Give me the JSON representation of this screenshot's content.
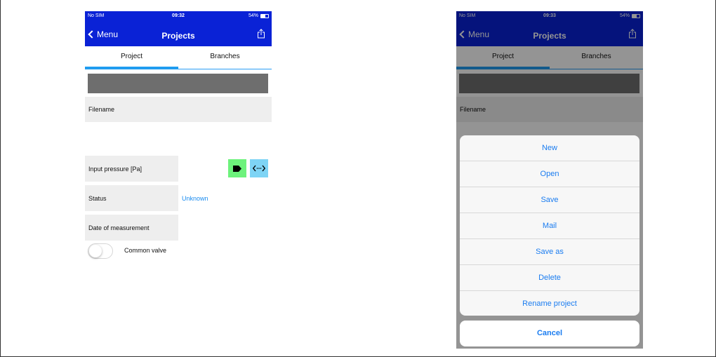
{
  "screens": [
    {
      "statusbar": {
        "carrier": "No SIM",
        "time": "09:32",
        "battery": "54%"
      },
      "nav": {
        "back_label": "Menu",
        "title": "Projects",
        "share_icon": "share-icon"
      },
      "tabs": [
        {
          "label": "Project",
          "selected": true
        },
        {
          "label": "Branches",
          "selected": false
        }
      ],
      "fields": {
        "filename_label": "Filename",
        "pressure_label": "Input pressure [Pa]",
        "status_label": "Status",
        "status_value": "Unknown",
        "date_label": "Date of measurement"
      },
      "toggle": {
        "label": "Common valve",
        "on": false
      }
    },
    {
      "statusbar": {
        "carrier": "No SIM",
        "time": "09:33",
        "battery": "54%"
      },
      "nav": {
        "back_label": "Menu",
        "title": "Projects",
        "share_icon": "share-icon"
      },
      "tabs": [
        {
          "label": "Project",
          "selected": true
        },
        {
          "label": "Branches",
          "selected": false
        }
      ],
      "fields": {
        "filename_label": "Filename"
      },
      "action_sheet": {
        "items": [
          "New",
          "Open",
          "Save",
          "Mail",
          "Save as",
          "Delete",
          "Rename project"
        ],
        "cancel": "Cancel"
      }
    }
  ],
  "colors": {
    "nav_bg": "#0a22d6",
    "tab_indicator": "#1f9cf0",
    "link": "#1a7cf0",
    "tag_button": "#6df27c",
    "code_button": "#7ed4f5"
  }
}
